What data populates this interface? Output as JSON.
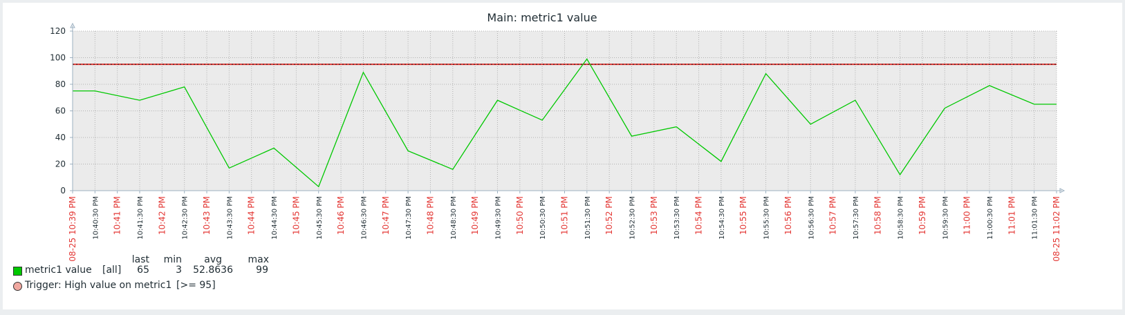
{
  "chart_data": {
    "type": "line",
    "title": "Main: metric1 value",
    "ylim": [
      0,
      120
    ],
    "y_ticks": [
      0,
      20,
      40,
      60,
      80,
      100,
      120
    ],
    "x_ticks": [
      {
        "label": "08-25 10:39 PM",
        "red": true
      },
      {
        "label": "10:40:30 PM",
        "red": false
      },
      {
        "label": "10:41 PM",
        "red": true
      },
      {
        "label": "10:41:30 PM",
        "red": false
      },
      {
        "label": "10:42 PM",
        "red": true
      },
      {
        "label": "10:42:30 PM",
        "red": false
      },
      {
        "label": "10:43 PM",
        "red": true
      },
      {
        "label": "10:43:30 PM",
        "red": false
      },
      {
        "label": "10:44 PM",
        "red": true
      },
      {
        "label": "10:44:30 PM",
        "red": false
      },
      {
        "label": "10:45 PM",
        "red": true
      },
      {
        "label": "10:45:30 PM",
        "red": false
      },
      {
        "label": "10:46 PM",
        "red": true
      },
      {
        "label": "10:46:30 PM",
        "red": false
      },
      {
        "label": "10:47 PM",
        "red": true
      },
      {
        "label": "10:47:30 PM",
        "red": false
      },
      {
        "label": "10:48 PM",
        "red": true
      },
      {
        "label": "10:48:30 PM",
        "red": false
      },
      {
        "label": "10:49 PM",
        "red": true
      },
      {
        "label": "10:49:30 PM",
        "red": false
      },
      {
        "label": "10:50 PM",
        "red": true
      },
      {
        "label": "10:50:30 PM",
        "red": false
      },
      {
        "label": "10:51 PM",
        "red": true
      },
      {
        "label": "10:51:30 PM",
        "red": false
      },
      {
        "label": "10:52 PM",
        "red": true
      },
      {
        "label": "10:52:30 PM",
        "red": false
      },
      {
        "label": "10:53 PM",
        "red": true
      },
      {
        "label": "10:53:30 PM",
        "red": false
      },
      {
        "label": "10:54 PM",
        "red": true
      },
      {
        "label": "10:54:30 PM",
        "red": false
      },
      {
        "label": "10:55 PM",
        "red": true
      },
      {
        "label": "10:55:30 PM",
        "red": false
      },
      {
        "label": "10:56 PM",
        "red": true
      },
      {
        "label": "10:56:30 PM",
        "red": false
      },
      {
        "label": "10:57 PM",
        "red": true
      },
      {
        "label": "10:57:30 PM",
        "red": false
      },
      {
        "label": "10:58 PM",
        "red": true
      },
      {
        "label": "10:58:30 PM",
        "red": false
      },
      {
        "label": "10:59 PM",
        "red": true
      },
      {
        "label": "10:59:30 PM",
        "red": false
      },
      {
        "label": "11:00 PM",
        "red": true
      },
      {
        "label": "11:00:30 PM",
        "red": false
      },
      {
        "label": "11:01 PM",
        "red": true
      },
      {
        "label": "11:01:30 PM",
        "red": false
      },
      {
        "label": "08-25 11:02 PM",
        "red": true
      }
    ],
    "series": [
      {
        "name": "metric1 value",
        "color": "#00c800",
        "points": [
          {
            "t": 0,
            "v": 75
          },
          {
            "t": 2,
            "v": 75
          },
          {
            "t": 6,
            "v": 68
          },
          {
            "t": 10,
            "v": 78
          },
          {
            "t": 14,
            "v": 17
          },
          {
            "t": 18,
            "v": 32
          },
          {
            "t": 22,
            "v": 3
          },
          {
            "t": 26,
            "v": 89
          },
          {
            "t": 30,
            "v": 30
          },
          {
            "t": 34,
            "v": 16
          },
          {
            "t": 38,
            "v": 68
          },
          {
            "t": 42,
            "v": 53
          },
          {
            "t": 46,
            "v": 99
          },
          {
            "t": 50,
            "v": 41
          },
          {
            "t": 54,
            "v": 48
          },
          {
            "t": 58,
            "v": 22
          },
          {
            "t": 62,
            "v": 88
          },
          {
            "t": 66,
            "v": 50
          },
          {
            "t": 70,
            "v": 68
          },
          {
            "t": 74,
            "v": 12
          },
          {
            "t": 78,
            "v": 62
          },
          {
            "t": 82,
            "v": 79
          },
          {
            "t": 86,
            "v": 65
          },
          {
            "t": 88,
            "v": 65
          }
        ]
      }
    ],
    "trigger": {
      "value": 95,
      "line_color": "#e33734",
      "dot_color": "#1a1a1a"
    },
    "colors": {
      "plot_bg": "#ebebeb",
      "grid": "#b0b0b0",
      "axis": "#9cb0c0",
      "tick_red": "#e33734",
      "tick_black": "#1f2c33"
    }
  },
  "legend": {
    "headers": {
      "last": "last",
      "min": "min",
      "avg": "avg",
      "max": "max"
    },
    "series_row": {
      "name": "metric1 value",
      "func": "[all]",
      "last": "65",
      "min": "3",
      "avg": "52.8636",
      "max": "99",
      "swatch_color": "#00c800"
    },
    "trigger_row": {
      "label": "Trigger: High value on metric1",
      "condition": "[>= 95]",
      "swatch_color": "#f0a8a0"
    }
  }
}
